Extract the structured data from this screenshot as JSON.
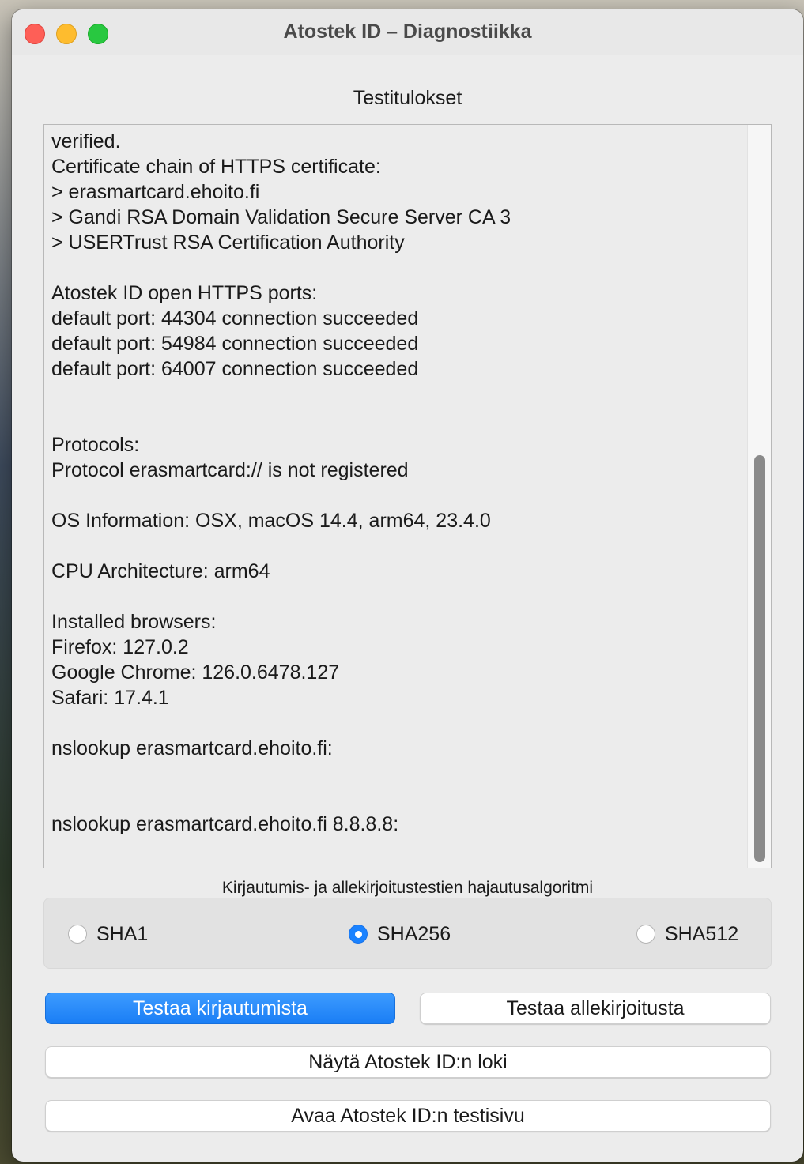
{
  "window": {
    "title": "Atostek ID – Diagnostiikka"
  },
  "results": {
    "label": "Testitulokset",
    "text": "verified.\nCertificate chain of HTTPS certificate:\n> erasmartcard.ehoito.fi\n> Gandi RSA Domain Validation Secure Server CA 3\n> USERTrust RSA Certification Authority\n\nAtostek ID open HTTPS ports:\ndefault port: 44304 connection succeeded\ndefault port: 54984 connection succeeded\ndefault port: 64007 connection succeeded\n\n\nProtocols:\nProtocol erasmartcard:// is not registered\n\nOS Information: OSX, macOS 14.4, arm64, 23.4.0\n\nCPU Architecture: arm64\n\nInstalled browsers:\nFirefox: 127.0.2\nGoogle Chrome: 126.0.6478.127\nSafari: 17.4.1\n\nnslookup erasmartcard.ehoito.fi:\n\n\nnslookup erasmartcard.ehoito.fi 8.8.8.8:"
  },
  "algorithm": {
    "label": "Kirjautumis- ja allekirjoitustestien hajautusalgoritmi",
    "options": [
      "SHA1",
      "SHA256",
      "SHA512"
    ],
    "selected": "SHA256"
  },
  "buttons": {
    "test_login": "Testaa kirjautumista",
    "test_sign": "Testaa allekirjoitusta",
    "show_log": "Näytä Atostek ID:n loki",
    "open_testpage": "Avaa Atostek ID:n testisivu"
  },
  "colors": {
    "accent": "#1a7ef5",
    "close": "#fe5f57",
    "minimize": "#febc2e",
    "maximize": "#28c840"
  }
}
